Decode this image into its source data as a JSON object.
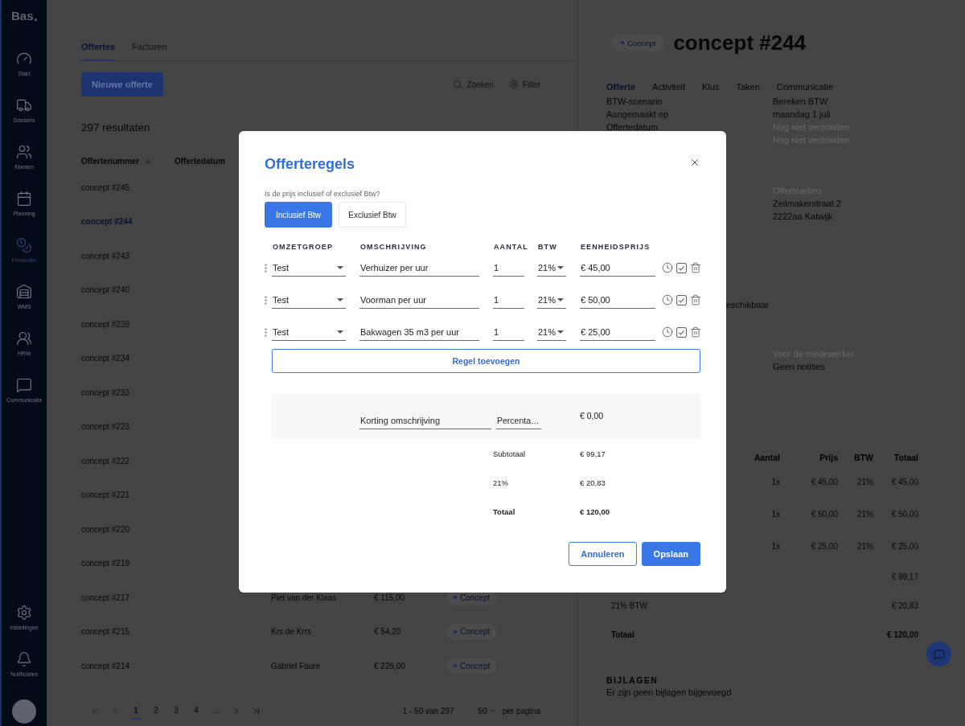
{
  "sidebar": {
    "logo": "Bas",
    "items": [
      {
        "label": "Start",
        "selected": false
      },
      {
        "label": "Dossiers",
        "selected": false
      },
      {
        "label": "Klanten",
        "selected": false
      },
      {
        "label": "Planning",
        "selected": false
      },
      {
        "label": "Financiën",
        "selected": true
      },
      {
        "label": "WMS",
        "selected": false
      },
      {
        "label": "HRM",
        "selected": false
      },
      {
        "label": "Communicatie",
        "selected": false
      }
    ],
    "bottom_items": [
      {
        "label": "Instellingen",
        "selected": false
      },
      {
        "label": "Notificaties",
        "selected": false
      }
    ]
  },
  "quotes": {
    "tabs": [
      {
        "label": "Offertes",
        "selected": true
      },
      {
        "label": "Facturen",
        "selected": false
      }
    ],
    "new_button": "Nieuwe offerte",
    "actions": [
      "Zoeken",
      "Filter"
    ],
    "result_count": "297 resultaten",
    "columns": [
      {
        "label": "Offertenummer",
        "sorted": true
      },
      {
        "label": "Offertedatum",
        "sorted": false
      }
    ],
    "rows": [
      {
        "number": "concept #245",
        "selected": false
      },
      {
        "number": "concept #244",
        "selected": true
      },
      {
        "number": "concept #243",
        "selected": false
      },
      {
        "number": "concept #240",
        "selected": false
      },
      {
        "number": "concept #239",
        "selected": false
      },
      {
        "number": "concept #234",
        "selected": false
      },
      {
        "number": "concept #233",
        "selected": false
      },
      {
        "number": "concept #223",
        "selected": false
      },
      {
        "number": "concept #222",
        "selected": false
      },
      {
        "number": "concept #221",
        "selected": false
      },
      {
        "number": "concept #220",
        "selected": false
      },
      {
        "number": "concept #219",
        "selected": false
      },
      {
        "number": "concept #217",
        "selected": false,
        "customer": "Piet van der Klaas",
        "amount": "€ 115,00",
        "status": "Concept"
      },
      {
        "number": "concept #215",
        "selected": false,
        "customer": "Krs de Krrs",
        "amount": "€ 54,20",
        "status": "Concept"
      },
      {
        "number": "concept #214",
        "selected": false,
        "customer": "Gabriel Faure",
        "amount": "€ 225,00",
        "status": "Concept"
      }
    ],
    "pagination": {
      "back_buttons": [
        {
          "kind": "first",
          "disabled": true
        },
        {
          "kind": "previous",
          "disabled": true
        }
      ],
      "pages": [
        {
          "label": "1",
          "selected": true
        },
        {
          "label": "2",
          "selected": false
        },
        {
          "label": "3",
          "selected": false
        },
        {
          "label": "4",
          "selected": false
        },
        {
          "label": "...",
          "selected": false
        }
      ],
      "forward_buttons": [
        {
          "kind": "next",
          "disabled": false
        },
        {
          "kind": "last",
          "disabled": false
        }
      ],
      "range": "1 - 50 van 297",
      "page_size": "50",
      "page_size_label": "per pagina"
    }
  },
  "detail": {
    "status": "Concept",
    "title": "concept #244",
    "tabs": [
      {
        "label": "Offerte",
        "selected": true
      },
      {
        "label": "Activiteit",
        "selected": false
      },
      {
        "label": "Klus",
        "selected": false
      },
      {
        "label": "Taken",
        "selected": false
      },
      {
        "label": "Communicatie",
        "selected": false
      }
    ],
    "info": [
      {
        "label": "BTW-scenario",
        "value": "Bereken BTW",
        "muted": false
      },
      {
        "label": "Aangemaakt op",
        "value": "maandag 1 juli",
        "muted": false
      },
      {
        "label": "Offertedatum",
        "value": "Nog niet verzonden",
        "muted": true
      },
      {
        "value": "Nog niet verzonden",
        "muted": true
      }
    ],
    "address": {
      "label": "Offerteadres",
      "lines": [
        "Zeilmakerstraat 2",
        "2222aa Katwijk"
      ]
    },
    "availability": "eschikbaar",
    "notes": {
      "label": "Voor de medewerker",
      "value": "Geen notities"
    },
    "items": {
      "columns": [
        "Aantal",
        "Prijs",
        "BTW",
        "Totaal"
      ],
      "rows": [
        {
          "quantity": "1x",
          "price": "€ 45,00",
          "vat": "21%",
          "total": "€ 45,00"
        },
        {
          "quantity": "1x",
          "price": "€ 50,00",
          "vat": "21%",
          "total": "€ 50,00"
        },
        {
          "quantity": "1x",
          "price": "€ 25,00",
          "vat": "21%",
          "total": "€ 25,00"
        }
      ],
      "totals": [
        {
          "value": "€ 99,17",
          "kind": "line"
        },
        {
          "label": "21% BTW",
          "value": "€ 20,83",
          "kind": "line"
        },
        {
          "label": "Totaal",
          "value": "€ 120,00",
          "kind": "total"
        }
      ]
    },
    "attachments": {
      "title": "BIJLAGEN",
      "text": "Er zijn geen bijlagen bijgevoegd"
    }
  },
  "modal": {
    "title": "Offerteregels",
    "question": "Is de prijs inclusief of exclusief Btw?",
    "price_modes": [
      {
        "label": "Inclusief Btw",
        "selected": true
      },
      {
        "label": "Exclusief Btw",
        "selected": false
      }
    ],
    "columns": [
      "OMZETGROEP",
      "OMSCHRIJVING",
      "AANTAL",
      "BTW",
      "EENHEIDSPRIJS"
    ],
    "lines": [
      {
        "group": "Test",
        "description": "Verhuizer per uur",
        "quantity": "1",
        "vat": "21%",
        "unit_price": "€ 45,00",
        "checked": true
      },
      {
        "group": "Test",
        "description": "Voorman per uur",
        "quantity": "1",
        "vat": "21%",
        "unit_price": "€ 50,00",
        "checked": true
      },
      {
        "group": "Test",
        "description": "Bakwagen 35 m3 per uur",
        "quantity": "1",
        "vat": "21%",
        "unit_price": "€ 25,00",
        "checked": true
      }
    ],
    "add_button": "Regel toevoegen",
    "discount": {
      "description": {
        "placeholder": "Korting omschrijving"
      },
      "percentage": {
        "placeholder": "Percenta…"
      },
      "amount": "€ 0,00"
    },
    "totals": [
      {
        "label": "Subtotaal",
        "value": "€ 99,17",
        "kind": "line"
      },
      {
        "label": "21%",
        "value": "€ 20,83",
        "kind": "line"
      },
      {
        "label": "Totaal",
        "value": "€ 120,00",
        "kind": "total"
      }
    ],
    "buttons": [
      {
        "label": "Annuleren",
        "kind": "secondary"
      },
      {
        "label": "Opslaan",
        "kind": "primary"
      }
    ]
  }
}
